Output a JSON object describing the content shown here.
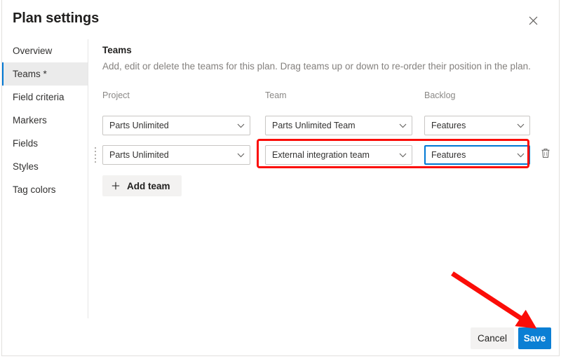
{
  "dialog": {
    "title": "Plan settings",
    "close_icon": "close-icon"
  },
  "sidebar": {
    "items": [
      {
        "label": "Overview",
        "selected": false
      },
      {
        "label": "Teams *",
        "selected": true
      },
      {
        "label": "Field criteria",
        "selected": false
      },
      {
        "label": "Markers",
        "selected": false
      },
      {
        "label": "Fields",
        "selected": false
      },
      {
        "label": "Styles",
        "selected": false
      },
      {
        "label": "Tag colors",
        "selected": false
      }
    ]
  },
  "main": {
    "section_title": "Teams",
    "section_desc": "Add, edit or delete the teams for this plan. Drag teams up or down to re-order their position in the plan.",
    "columns": {
      "project": "Project",
      "team": "Team",
      "backlog": "Backlog"
    },
    "rows": [
      {
        "project": "Parts Unlimited",
        "team": "Parts Unlimited Team",
        "backlog": "Features"
      },
      {
        "project": "Parts Unlimited",
        "team": "External integration team",
        "backlog": "Features"
      }
    ],
    "add_team_label": "Add team",
    "add_team_icon": "plus-icon",
    "delete_icon": "trash-icon",
    "drag_icon": "drag-handle-icon",
    "chevron_icon": "chevron-down-icon"
  },
  "footer": {
    "cancel_label": "Cancel",
    "save_label": "Save"
  },
  "annotations": {
    "highlight_color": "#fb0d08",
    "arrow_color": "#fb0d08"
  },
  "colors": {
    "accent": "#0078d4",
    "save_blue": "#0b7fd4",
    "selected_nav_bg": "#ebebeb",
    "button_bg": "#f3f2f1",
    "border": "#c8c6c4",
    "muted_text": "#8a8886"
  }
}
